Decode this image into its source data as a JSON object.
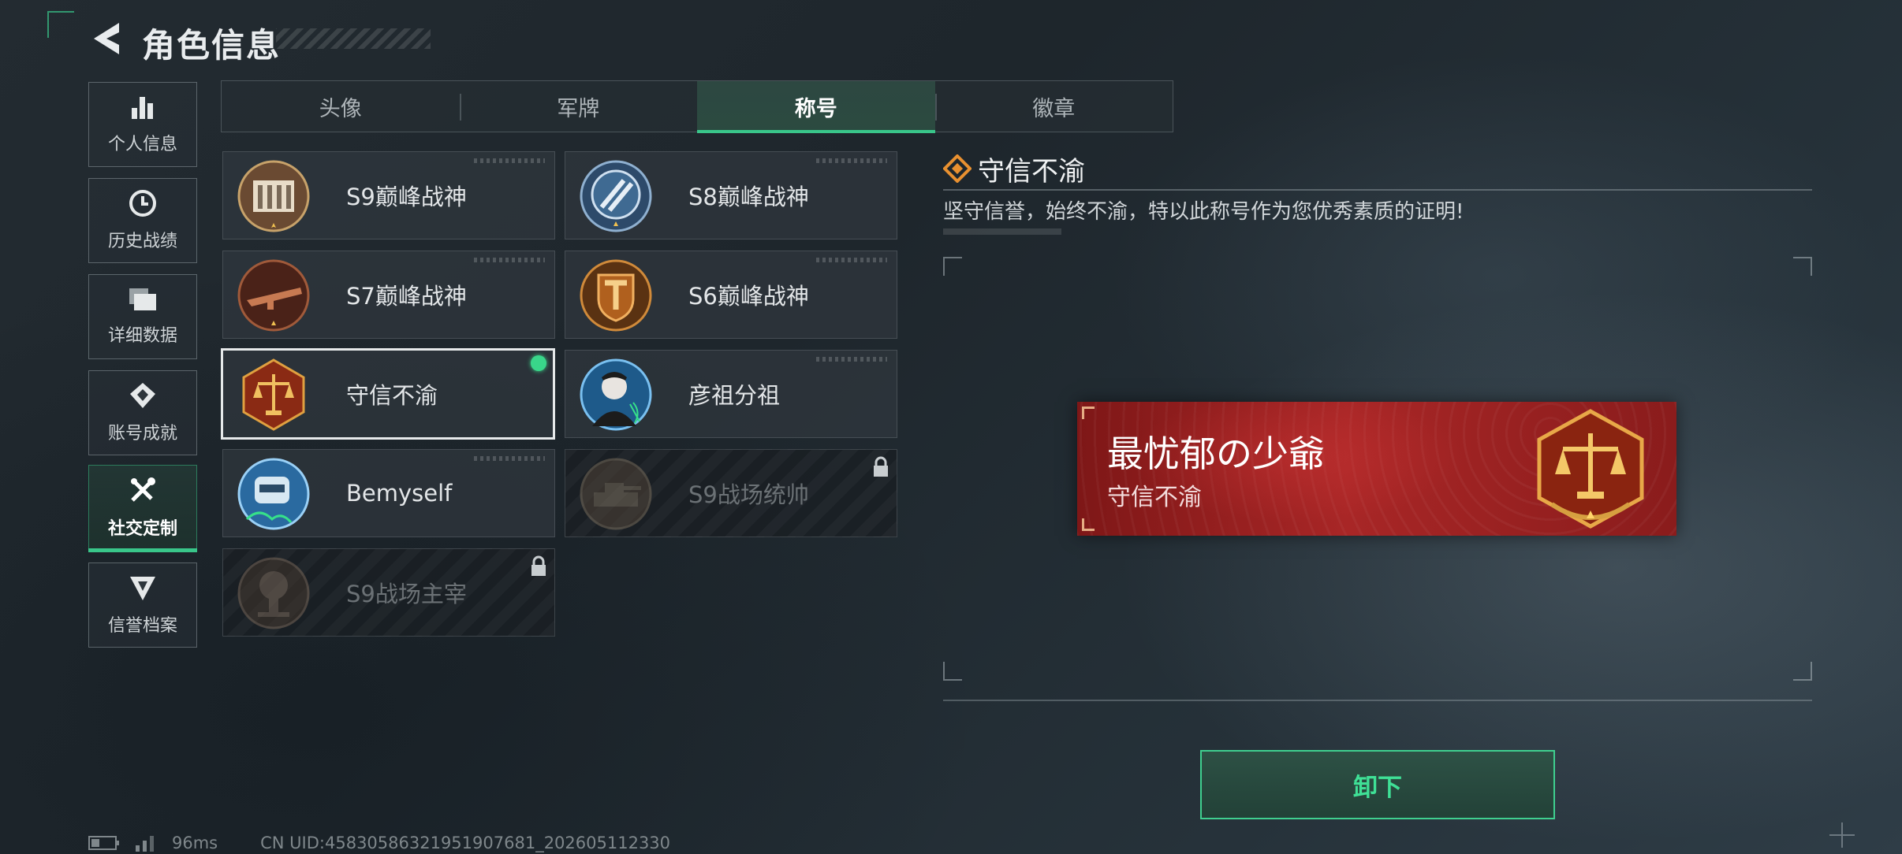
{
  "header": {
    "title": "角色信息"
  },
  "nav": {
    "items": [
      {
        "label": "个人信息",
        "icon": "bar-chart-icon"
      },
      {
        "label": "历史战绩",
        "icon": "clock-icon"
      },
      {
        "label": "详细数据",
        "icon": "folder-icon"
      },
      {
        "label": "账号成就",
        "icon": "achievement-icon"
      },
      {
        "label": "社交定制",
        "icon": "wrench-screwdriver-icon",
        "active": true
      },
      {
        "label": "信誉档案",
        "icon": "shield-wing-icon"
      }
    ]
  },
  "tabs": [
    {
      "label": "头像"
    },
    {
      "label": "军牌"
    },
    {
      "label": "称号",
      "active": true
    },
    {
      "label": "徽章"
    }
  ],
  "titles": [
    {
      "name": "S9巅峰战神",
      "emblem": "fortress-emblem-icon"
    },
    {
      "name": "S8巅峰战神",
      "emblem": "blue-crest-emblem-icon"
    },
    {
      "name": "S7巅峰战神",
      "emblem": "rifle-emblem-icon"
    },
    {
      "name": "S6巅峰战神",
      "emblem": "gold-shield-emblem-icon"
    },
    {
      "name": "守信不渝",
      "emblem": "scales-emblem-icon",
      "selected": true,
      "equipped": true
    },
    {
      "name": "彦祖分祖",
      "emblem": "portrait-emblem-icon"
    },
    {
      "name": "Bemyself",
      "emblem": "soldier-emblem-icon"
    },
    {
      "name": "S9战场统帅",
      "emblem": "tank-emblem-icon",
      "locked": true
    },
    {
      "name": "S9战场主宰",
      "emblem": "explosion-emblem-icon",
      "locked": true
    }
  ],
  "detail": {
    "title": "守信不渝",
    "description": "坚守信誉，始终不渝，特以此称号作为您优秀素质的证明!"
  },
  "preview": {
    "player_name": "最忧郁の少爺",
    "title": "守信不渝",
    "emblem": "scales-emblem-icon"
  },
  "actions": {
    "unequip_label": "卸下"
  },
  "footer": {
    "ping": "96ms",
    "uid": "CN UID:4583058632195190768​1_202605112330"
  },
  "colors": {
    "accent": "#39c68a",
    "banner_red": "#a82626",
    "gold": "#e0a040"
  }
}
